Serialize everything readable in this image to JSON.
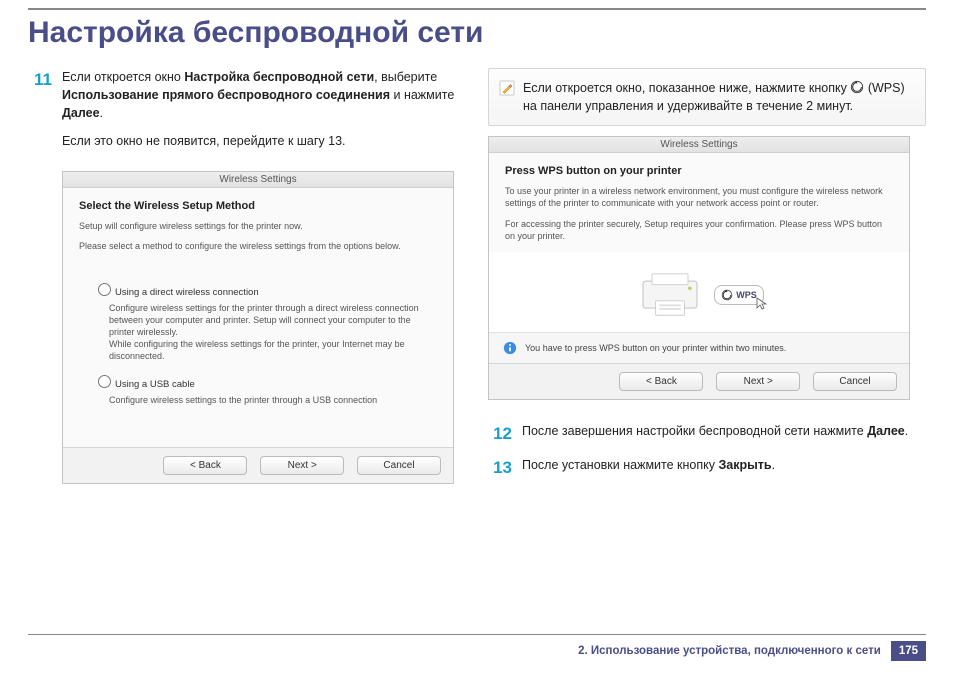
{
  "title": "Настройка беспроводной сети",
  "steps": {
    "s11_num": "11",
    "s11_prefix": "Если откроется окно ",
    "s11_bold1": "Настройка беспроводной сети",
    "s11_mid": ", выберите ",
    "s11_bold2": "Использование прямого беспроводного соединения",
    "s11_mid2": " и нажмите ",
    "s11_bold3": "Далее",
    "s11_suffix": ".",
    "s11_line2": "Если это окно не появится, перейдите к шагу 13.",
    "s12_num": "12",
    "s12_text_a": "После завершения настройки беспроводной сети нажмите ",
    "s12_bold": "Далее",
    "s12_suffix": ".",
    "s13_num": "13",
    "s13_text_a": "После установки нажмите кнопку ",
    "s13_bold": "Закрыть",
    "s13_suffix": "."
  },
  "dialog1": {
    "title": "Wireless Settings",
    "heading": "Select the Wireless Setup Method",
    "sub1": "Setup will configure wireless settings for the printer now.",
    "sub2": "Please select a method to configure the wireless settings from the options below.",
    "opt1": "Using a direct wireless connection",
    "opt1_desc": "Configure wireless settings for the printer through a direct wireless connection between your computer and printer. Setup will connect your computer to the printer wirelessly.\nWhile configuring the wireless settings for the printer, your Internet may be disconnected.",
    "opt2": "Using a USB cable",
    "opt2_desc": "Configure wireless settings to the printer through a USB connection",
    "back": "< Back",
    "next": "Next >",
    "cancel": "Cancel"
  },
  "note": {
    "text_a": "Если откроется окно, показанное ниже, нажмите кнопку ",
    "wps": "(WPS)",
    "text_b": " на панели управления и удерживайте в течение 2 минут."
  },
  "dialog2": {
    "title": "Wireless Settings",
    "heading": "Press WPS button on your printer",
    "p1": "To use your printer in a wireless network environment, you must configure the wireless network settings of the printer to communicate with your network access point or router.",
    "p2": "For accessing the printer securely, Setup requires your confirmation. Please press WPS button on your printer.",
    "wps_label": "WPS",
    "warn": "You have to press WPS button on your printer within two minutes.",
    "back": "< Back",
    "next": "Next >",
    "cancel": "Cancel"
  },
  "footer": {
    "chapter": "2.  Использование устройства, подключенного к сети",
    "page": "175"
  }
}
